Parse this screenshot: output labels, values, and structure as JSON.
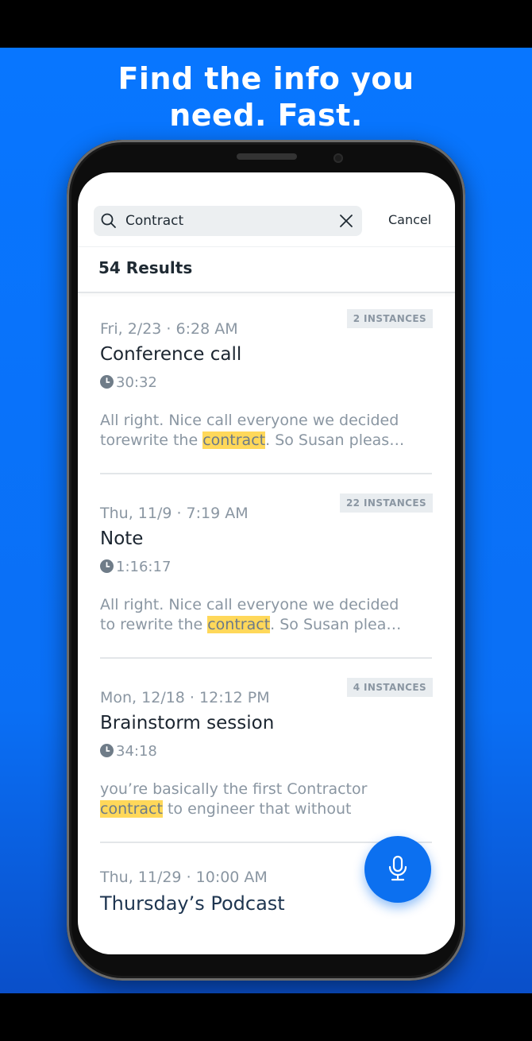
{
  "headline": {
    "line1": "Find the info you",
    "line2": "need. Fast."
  },
  "search": {
    "query": "Contract",
    "cancel_label": "Cancel"
  },
  "results_count": "54 Results",
  "results": [
    {
      "date": "Fri, 2/23 · 6:28 AM",
      "instances": "2 INSTANCES",
      "title": "Conference call",
      "duration": "30:32",
      "snippet_line1": "All right. Nice call everyone we decided",
      "snippet_pre": "torewrite the ",
      "snippet_highlight": "contract",
      "snippet_post": ". So Susan pleas…"
    },
    {
      "date": "Thu, 11/9 · 7:19 AM",
      "instances": "22 INSTANCES",
      "title": "Note",
      "duration": "1:16:17",
      "snippet_line1": "All right. Nice call everyone we decided",
      "snippet_pre": "to rewrite the ",
      "snippet_highlight": "contract",
      "snippet_post": ". So Susan plea…"
    },
    {
      "date": "Mon, 12/18 · 12:12 PM",
      "instances": "4 INSTANCES",
      "title": "Brainstorm session",
      "duration": "34:18",
      "snippet_line1": "you’re basically the first Contractor",
      "snippet_pre": "",
      "snippet_highlight": "contract",
      "snippet_post": " to engineer that without"
    }
  ],
  "partial_result": {
    "date": "Thu, 11/29 · 10:00 AM",
    "title": "Thursday’s Podcast"
  },
  "icons": {
    "search": "search-icon",
    "clear": "close-icon",
    "duration": "clock-icon",
    "mic": "microphone-icon"
  },
  "colors": {
    "background_blue": "#0876ff",
    "fab_blue": "#0c70f0",
    "highlight": "#ffd85a",
    "badge_bg": "#e9edf0",
    "muted_text": "#8a96a2"
  }
}
